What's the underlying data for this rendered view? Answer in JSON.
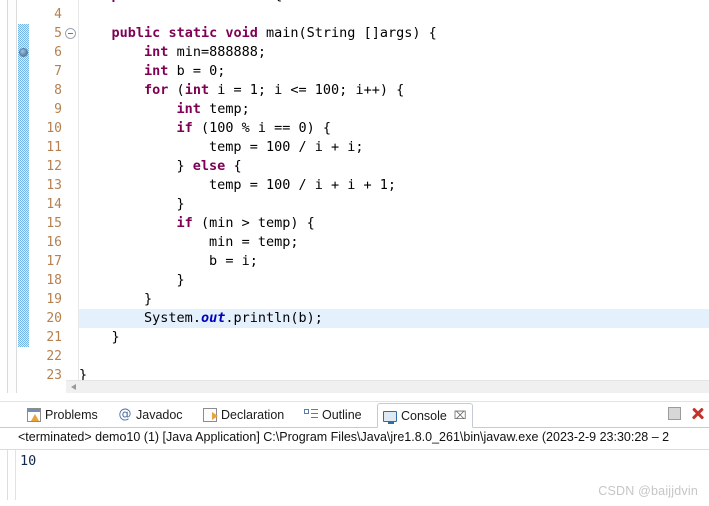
{
  "editor": {
    "first_line_number": 4,
    "current_line_number": 20,
    "change_bar_range": [
      5,
      21
    ],
    "breakpoint_line": 6,
    "fold_marker_line": 5,
    "accent_change_bar_color": "#73b3e7",
    "keyword_color": "#7f0055",
    "static_field_color": "#0000c0",
    "current_line_highlight_color": "#e5f0fd",
    "line_number_color": "#b5814f",
    "lines": [
      {
        "num": 4,
        "text": ""
      },
      {
        "num": 5,
        "text": "    public static void main(String []args) {"
      },
      {
        "num": 6,
        "text": "        int min=888888;"
      },
      {
        "num": 7,
        "text": "        int b = 0;"
      },
      {
        "num": 8,
        "text": "        for (int i = 1; i <= 100; i++) {"
      },
      {
        "num": 9,
        "text": "            int temp;"
      },
      {
        "num": 10,
        "text": "            if (100 % i == 0) {"
      },
      {
        "num": 11,
        "text": "                temp = 100 / i + i;"
      },
      {
        "num": 12,
        "text": "            } else {"
      },
      {
        "num": 13,
        "text": "                temp = 100 / i + i + 1;"
      },
      {
        "num": 14,
        "text": "            }"
      },
      {
        "num": 15,
        "text": "            if (min > temp) {"
      },
      {
        "num": 16,
        "text": "                min = temp;"
      },
      {
        "num": 17,
        "text": "                b = i;"
      },
      {
        "num": 18,
        "text": "            }"
      },
      {
        "num": 19,
        "text": "        }"
      },
      {
        "num": 20,
        "text": "        System.out.println(b);"
      },
      {
        "num": 21,
        "text": "    }"
      },
      {
        "num": 22,
        "text": ""
      },
      {
        "num": 23,
        "text": "}"
      }
    ]
  },
  "bottom_panel": {
    "tabs": [
      {
        "label": "Problems",
        "icon": "problems-icon",
        "active": false,
        "closable": false
      },
      {
        "label": "Javadoc",
        "icon": "javadoc-icon",
        "active": false,
        "closable": false
      },
      {
        "label": "Declaration",
        "icon": "declaration-icon",
        "active": false,
        "closable": false
      },
      {
        "label": "Outline",
        "icon": "outline-icon",
        "active": false,
        "closable": false
      },
      {
        "label": "Console",
        "icon": "console-icon",
        "active": true,
        "closable": true
      }
    ],
    "tab_close_glyph": "⌧",
    "toolbar": {
      "minimize_label": "Minimize",
      "close_label": "Close"
    },
    "status_line": "<terminated> demo10 (1) [Java Application] C:\\Program Files\\Java\\jre1.8.0_261\\bin\\javaw.exe  (2023-2-9 23:30:28 – 2",
    "console_output": "10",
    "console_output_color": "#13294b"
  },
  "watermark": {
    "text": "CSDN @baijjdvin"
  }
}
